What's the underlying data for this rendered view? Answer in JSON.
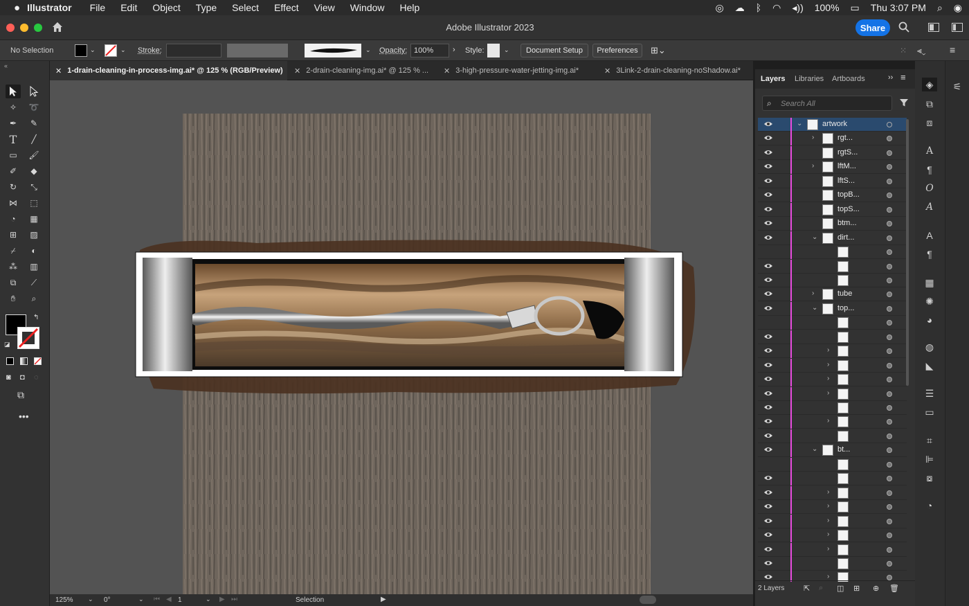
{
  "menubar": {
    "app": "Illustrator",
    "items": [
      "File",
      "Edit",
      "Object",
      "Type",
      "Select",
      "Effect",
      "View",
      "Window",
      "Help"
    ],
    "battery": "100%",
    "clock": "Thu 3:07 PM"
  },
  "window": {
    "title": "Adobe Illustrator 2023",
    "share_label": "Share"
  },
  "control": {
    "selection": "No Selection",
    "stroke_label": "Stroke:",
    "opacity_label": "Opacity:",
    "opacity_value": "100%",
    "style_label": "Style:",
    "document_setup": "Document Setup",
    "preferences": "Preferences"
  },
  "tabs": [
    {
      "label": "1-drain-cleaning-in-process-img.ai* @ 125 % (RGB/Preview)",
      "active": true
    },
    {
      "label": "2-drain-cleaning-img.ai* @ 125 % ...",
      "active": false
    },
    {
      "label": "3-high-pressure-water-jetting-img.ai*",
      "active": false
    },
    {
      "label": "3Link-2-drain-cleaning-noShadow.ai*",
      "active": false
    }
  ],
  "panel": {
    "tabs": [
      "Layers",
      "Libraries",
      "Artboards"
    ],
    "search_placeholder": "Search All",
    "layers": [
      {
        "name": "artwork",
        "depth": 0,
        "chevron": "open",
        "eye": true,
        "selected": true
      },
      {
        "name": "rgt...",
        "depth": 1,
        "chevron": "closed",
        "eye": true
      },
      {
        "name": "rgtS...",
        "depth": 1,
        "chevron": "",
        "eye": true
      },
      {
        "name": "lftM...",
        "depth": 1,
        "chevron": "closed",
        "eye": true
      },
      {
        "name": "lftS...",
        "depth": 1,
        "chevron": "",
        "eye": true
      },
      {
        "name": "topB...",
        "depth": 1,
        "chevron": "",
        "eye": true
      },
      {
        "name": "topS...",
        "depth": 1,
        "chevron": "",
        "eye": true
      },
      {
        "name": "btm...",
        "depth": 1,
        "chevron": "",
        "eye": true
      },
      {
        "name": "dirt...",
        "depth": 1,
        "chevron": "open",
        "eye": true
      },
      {
        "name": "",
        "depth": 2,
        "chevron": "",
        "eye": false
      },
      {
        "name": "",
        "depth": 2,
        "chevron": "",
        "eye": true
      },
      {
        "name": "",
        "depth": 2,
        "chevron": "",
        "eye": true
      },
      {
        "name": "tube",
        "depth": 1,
        "chevron": "closed",
        "eye": true
      },
      {
        "name": "top...",
        "depth": 1,
        "chevron": "open",
        "eye": true
      },
      {
        "name": "",
        "depth": 2,
        "chevron": "",
        "eye": false
      },
      {
        "name": "",
        "depth": 2,
        "chevron": "",
        "eye": true
      },
      {
        "name": "",
        "depth": 2,
        "chevron": "closed",
        "eye": true
      },
      {
        "name": "",
        "depth": 2,
        "chevron": "closed",
        "eye": true
      },
      {
        "name": "",
        "depth": 2,
        "chevron": "closed",
        "eye": true
      },
      {
        "name": "",
        "depth": 2,
        "chevron": "closed",
        "eye": true
      },
      {
        "name": "",
        "depth": 2,
        "chevron": "",
        "eye": true
      },
      {
        "name": "",
        "depth": 2,
        "chevron": "closed",
        "eye": true
      },
      {
        "name": "",
        "depth": 2,
        "chevron": "",
        "eye": true
      },
      {
        "name": "bt...",
        "depth": 1,
        "chevron": "open",
        "eye": true
      },
      {
        "name": "",
        "depth": 2,
        "chevron": "",
        "eye": false
      },
      {
        "name": "",
        "depth": 2,
        "chevron": "",
        "eye": true
      },
      {
        "name": "",
        "depth": 2,
        "chevron": "closed",
        "eye": true
      },
      {
        "name": "",
        "depth": 2,
        "chevron": "closed",
        "eye": true
      },
      {
        "name": "",
        "depth": 2,
        "chevron": "closed",
        "eye": true
      },
      {
        "name": "",
        "depth": 2,
        "chevron": "closed",
        "eye": true
      },
      {
        "name": "",
        "depth": 2,
        "chevron": "closed",
        "eye": true
      },
      {
        "name": "",
        "depth": 2,
        "chevron": "",
        "eye": true
      },
      {
        "name": "",
        "depth": 2,
        "chevron": "closed",
        "eye": true
      }
    ],
    "footer_count": "2 Layers"
  },
  "status": {
    "zoom": "125%",
    "rotation": "0°",
    "artboard": "1",
    "tool": "Selection"
  },
  "colors": {
    "accent": "#1473e6",
    "layer_color": "#e94be0",
    "selected_row": "#2a4a6e"
  }
}
